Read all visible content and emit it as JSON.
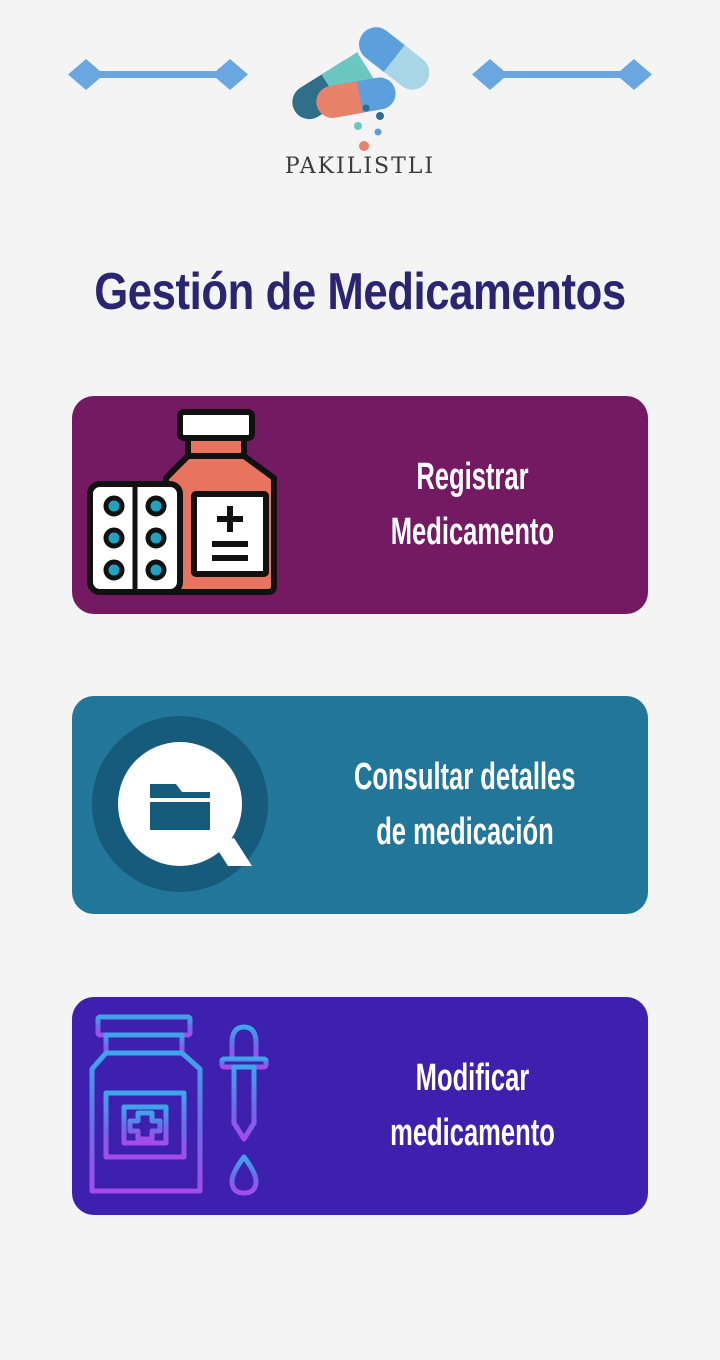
{
  "header": {
    "brand_name": "PAKILISTLI",
    "logo_icon": "pill-capsules-logo",
    "decoration_icon": "diamond-line-divider"
  },
  "page": {
    "title": "Gestión de Medicamentos"
  },
  "menu": {
    "items": [
      {
        "id": "register",
        "label_line1": "Registrar",
        "label_line2": "Medicamento",
        "icon": "medicine-bottle-pills-icon",
        "color": "#731a62"
      },
      {
        "id": "consult",
        "label_line1": "Consultar detalles",
        "label_line2": "de medicación",
        "icon": "folder-search-icon",
        "color": "#21769a"
      },
      {
        "id": "modify",
        "label_line1": "Modificar",
        "label_line2": "medicamento",
        "icon": "bottle-dropper-icon",
        "color": "#3d20ae"
      }
    ]
  },
  "colors": {
    "background": "#f4f4f5",
    "title": "#2b2470",
    "accent_line": "#6aa6e0"
  }
}
